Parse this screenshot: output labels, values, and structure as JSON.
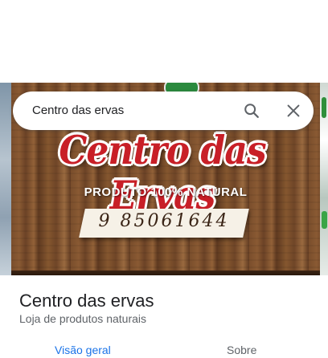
{
  "search": {
    "query": "Centro das ervas"
  },
  "hero": {
    "sign_title": "Centro das Ervas",
    "sign_tagline": "PRODUTO 100% NATURAL",
    "sign_phone": "9 85061644"
  },
  "place": {
    "name": "Centro das ervas",
    "category": "Loja de produtos naturais"
  },
  "tabs": [
    {
      "label": "Visão geral",
      "active": true
    },
    {
      "label": "Sobre",
      "active": false
    }
  ],
  "colors": {
    "accent": "#1a73e8",
    "text_primary": "#202124",
    "text_secondary": "#5f6368",
    "sign_red": "#c81f27"
  },
  "icons": {
    "search": "search-icon",
    "close": "close-icon"
  }
}
